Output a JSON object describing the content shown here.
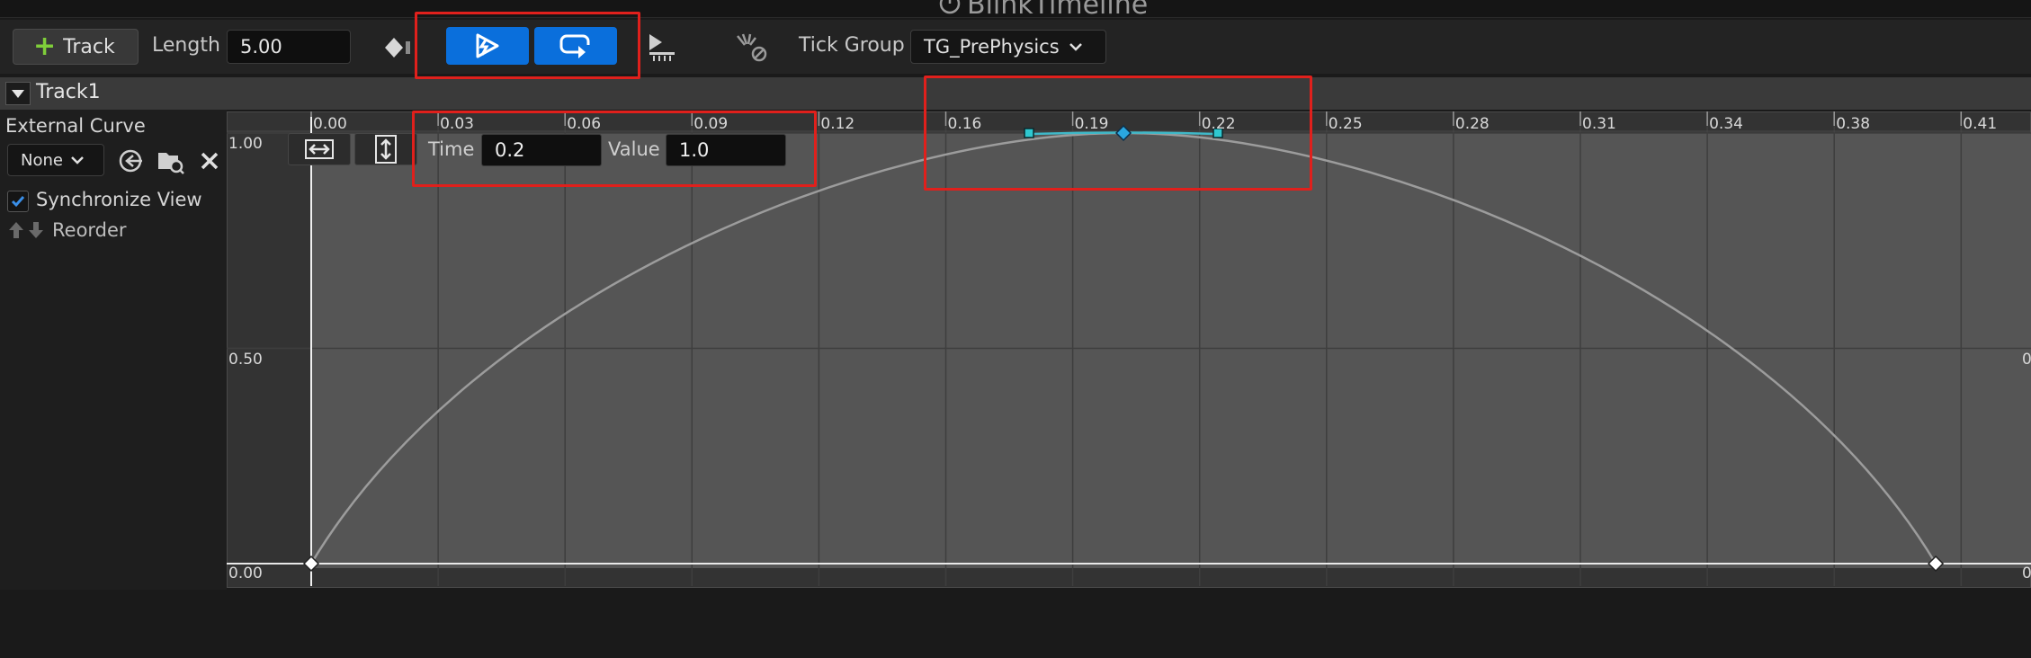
{
  "window": {
    "title": "BlinkTimeline"
  },
  "toolbar": {
    "add_track_label": "Track",
    "length_label": "Length",
    "length_value": "5.00",
    "tick_group_label": "Tick Group",
    "tick_group_value": "TG_PrePhysics"
  },
  "track": {
    "name": "Track1"
  },
  "left_panel": {
    "external_curve_label": "External Curve",
    "curve_select_value": "None",
    "synchronize_view_label": "Synchronize View",
    "synchronize_view_checked": true,
    "reorder_label": "Reorder"
  },
  "graph": {
    "x_ticks": [
      "0.00",
      "0.03",
      "0.06",
      "0.09",
      "0.12",
      "0.16",
      "0.19",
      "0.22",
      "0.25",
      "0.28",
      "0.31",
      "0.34",
      "0.38",
      "0.41"
    ],
    "y_labels": [
      "1.00",
      "0.50",
      "0.00"
    ],
    "right_y_labels": [
      "0",
      "0"
    ],
    "time_label": "Time",
    "time_value": "0.2",
    "value_label": "Value",
    "value_value": "1.0",
    "keys": [
      {
        "time": 0.0,
        "value": 0.0
      },
      {
        "time": 0.2,
        "value": 1.0
      },
      {
        "time": 0.4,
        "value": 0.0
      }
    ],
    "curve_color": "#9c9c9c",
    "selected_tangent_color": "#3fb8c8",
    "selected_key_color": "#2aa7e0"
  },
  "colors": {
    "accent_blue": "#0a6fdc",
    "highlight_red": "#e0201c",
    "add_green": "#7fce3a"
  }
}
